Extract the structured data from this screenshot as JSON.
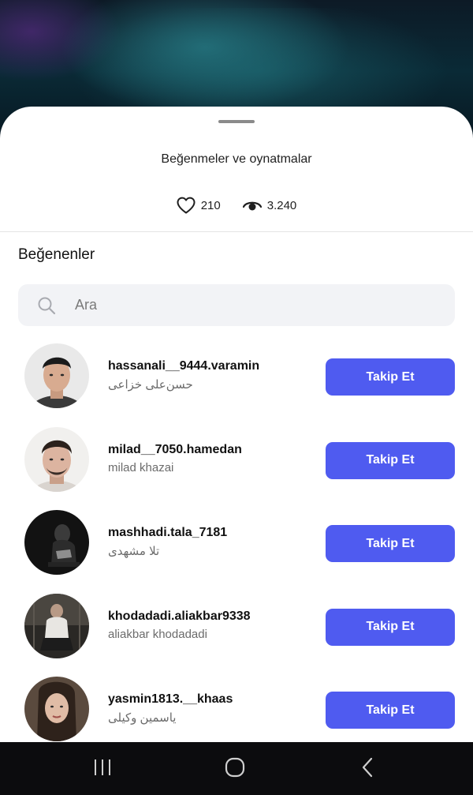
{
  "sheet": {
    "title": "Beğenmeler ve oynatmalar",
    "likes": "210",
    "views": "3.240"
  },
  "likers": {
    "section_title": "Beğenenler",
    "search_placeholder": "Ara",
    "follow_label": "Takip Et",
    "items": [
      {
        "username": "hassanali__9444.varamin",
        "fullname": "حسن‌علی خزاعی"
      },
      {
        "username": "milad__7050.hamedan",
        "fullname": "milad khazai"
      },
      {
        "username": "mashhadi.tala_7181",
        "fullname": "تلا مشهدی"
      },
      {
        "username": "khodadadi.aliakbar9338",
        "fullname": "aliakbar khodadadi"
      },
      {
        "username": "yasmin1813.__khaas",
        "fullname": "یاسمین وکیلی"
      }
    ]
  },
  "colors": {
    "accent": "#4f5bf0",
    "navbar": "#0c0c0e"
  },
  "icons": {
    "likes": "heart-icon",
    "views": "eye-icon",
    "search": "search-icon",
    "nav_recents": "recents-icon",
    "nav_home": "home-icon",
    "nav_back": "back-icon"
  }
}
